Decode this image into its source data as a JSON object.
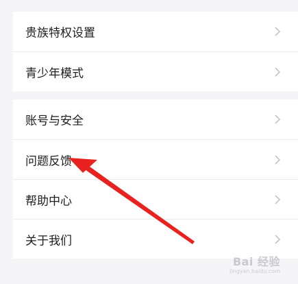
{
  "settings": {
    "group1": [
      {
        "label": "贵族特权设置"
      },
      {
        "label": "青少年模式"
      }
    ],
    "group2": [
      {
        "label": "账号与安全"
      },
      {
        "label": "问题反馈"
      },
      {
        "label": "帮助中心"
      },
      {
        "label": "关于我们"
      }
    ]
  },
  "icons": {
    "chevron": "chevron-right-icon"
  },
  "colors": {
    "background": "#f5f5f7",
    "card": "#ffffff",
    "text": "#1e1e1e",
    "chevron": "#c4c4c8",
    "annotation_arrow": "#e8231f"
  },
  "watermark": {
    "brand": "Bai 经验",
    "url": "jingyan.baidu.com"
  }
}
